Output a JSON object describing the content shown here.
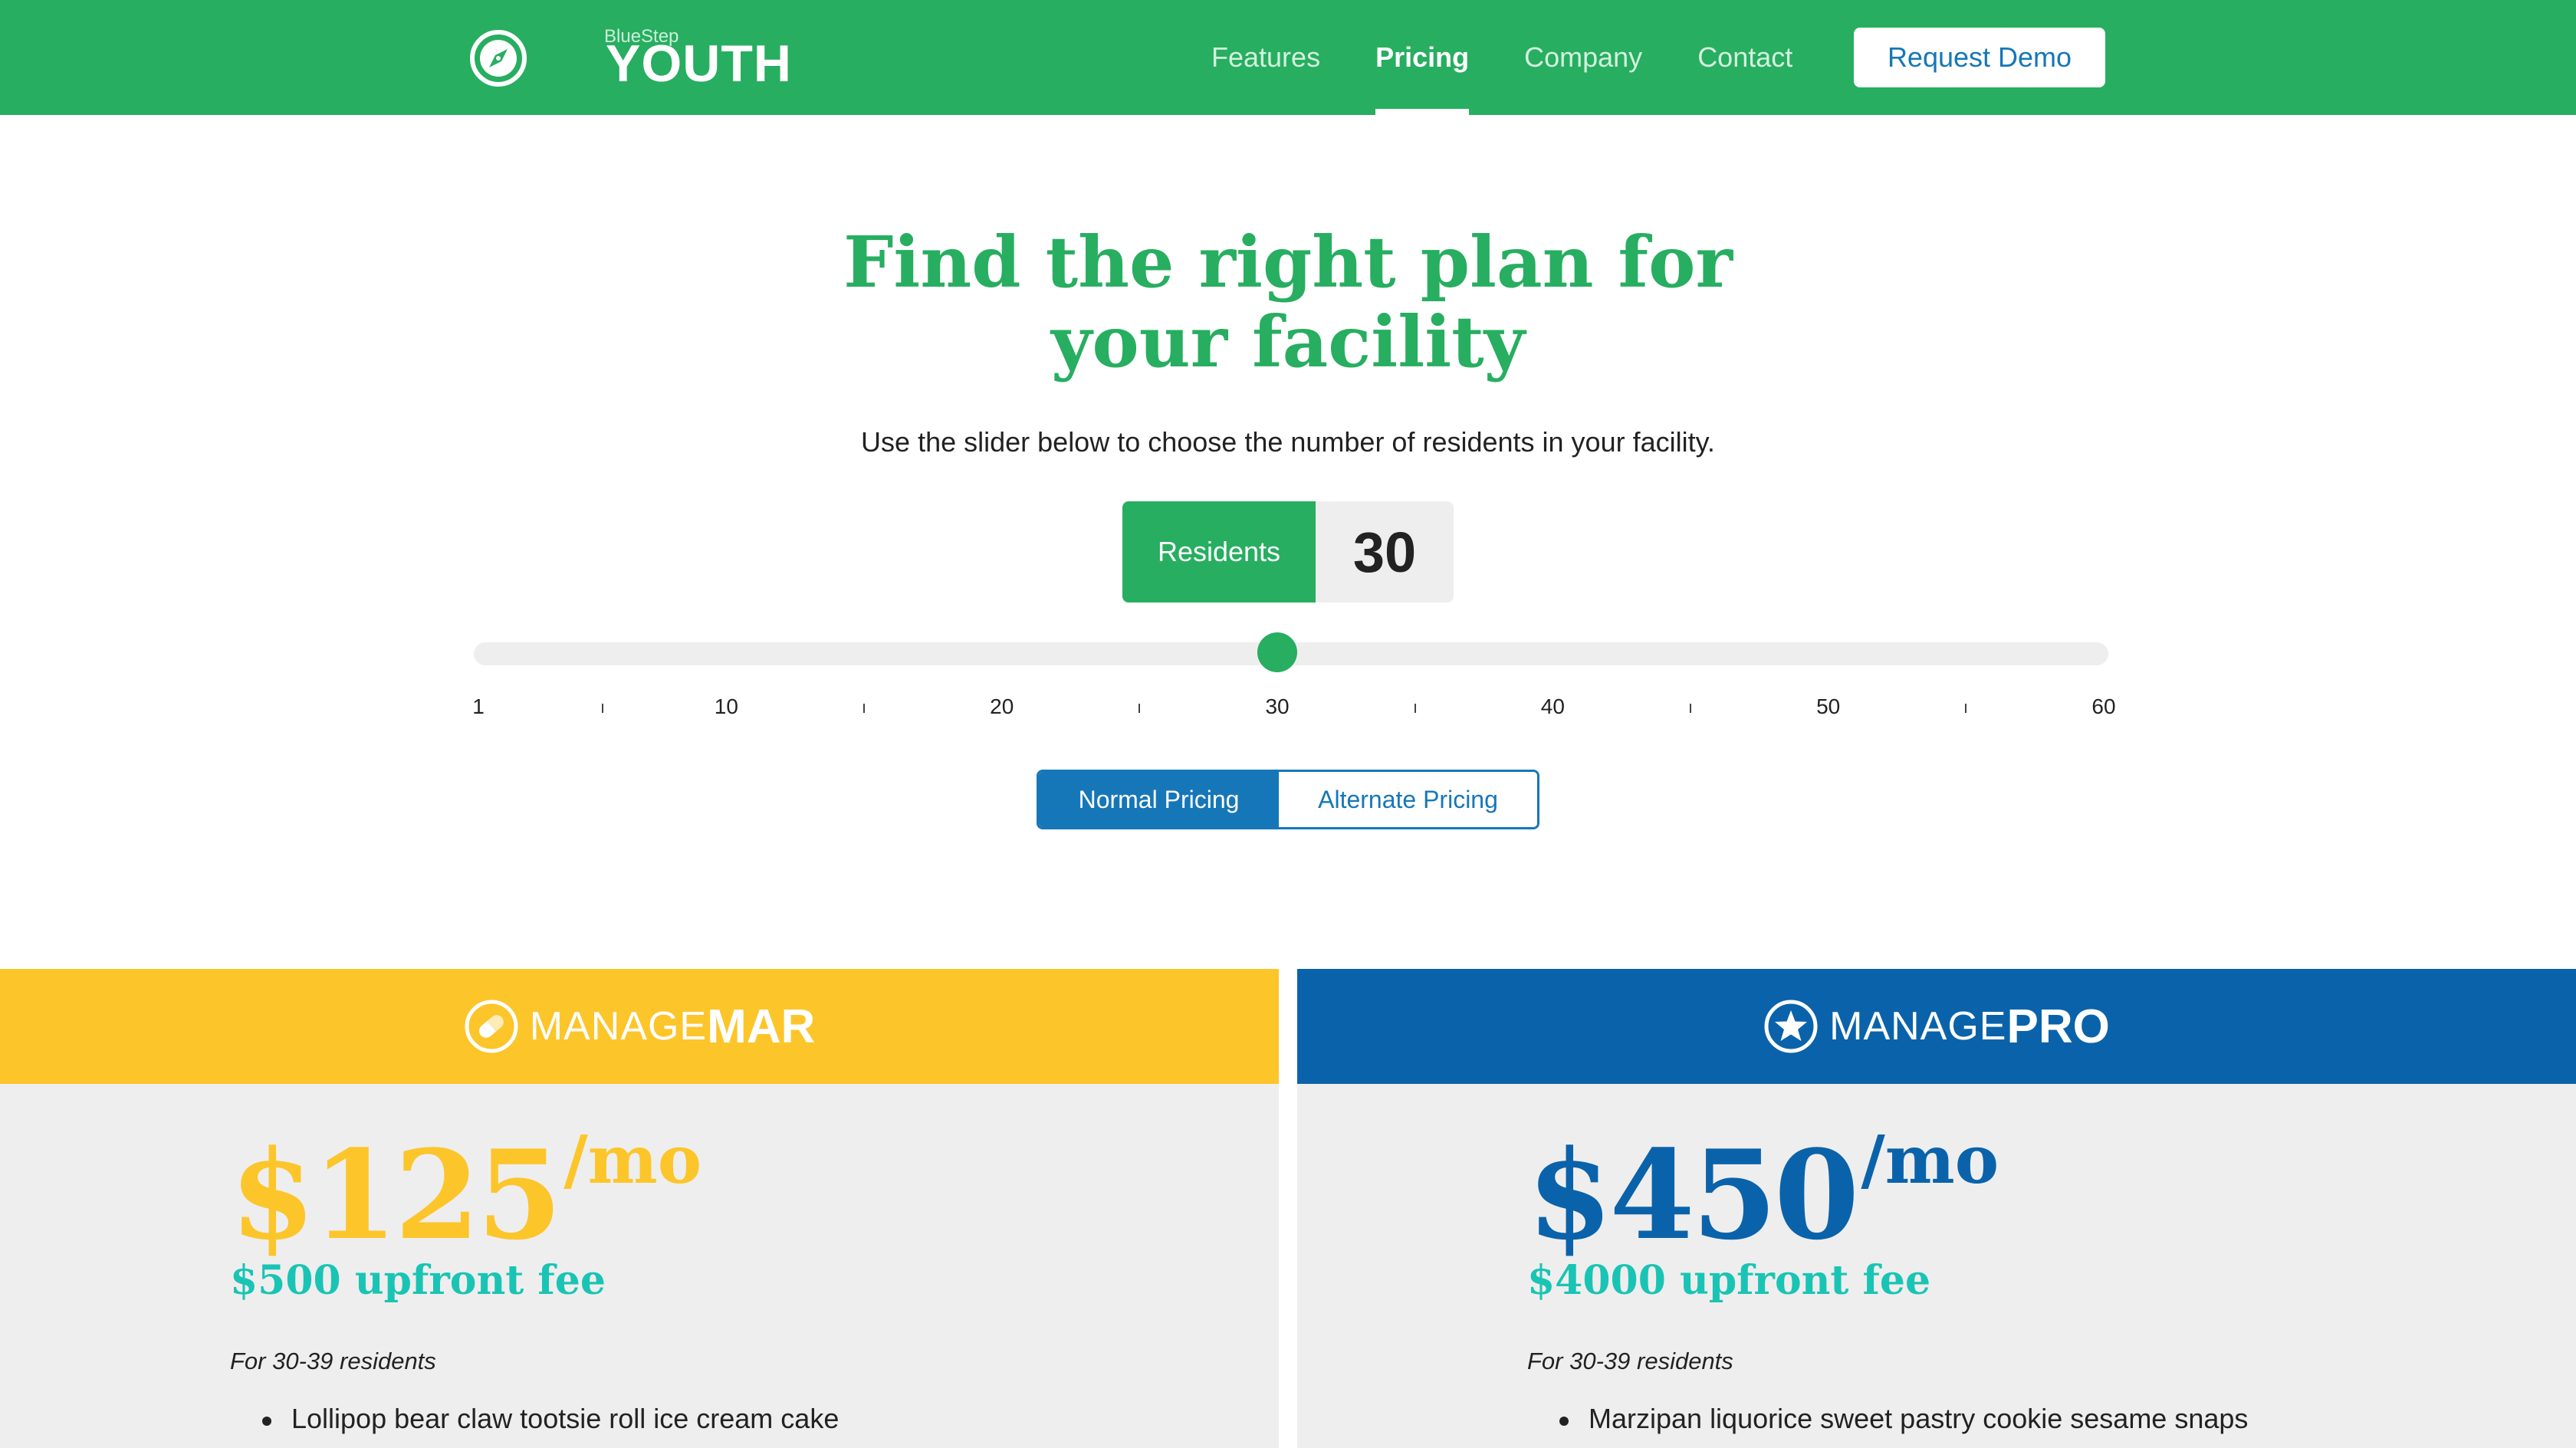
{
  "colors": {
    "brand_green": "#27ae60",
    "accent_blue": "#1677b8",
    "mar_yellow": "#fcc52a",
    "pro_blue": "#0a63aa",
    "fee_teal": "#1ac4b4"
  },
  "nav": {
    "logo_small": "BlueStep",
    "logo_big": "YOUTH",
    "logo_icon": "compass-icon",
    "links": [
      "Features",
      "Pricing",
      "Company",
      "Contact"
    ],
    "active_link": "Pricing",
    "demo_button": "Request Demo"
  },
  "hero": {
    "title_line1": "Find the right plan for",
    "title_line2": "your facility",
    "subtitle": "Use the slider below to choose the number of residents in your facility."
  },
  "residents": {
    "label": "Residents",
    "value": "30"
  },
  "slider": {
    "min": 1,
    "max": 60,
    "value": 30,
    "tick_labels": [
      "1",
      "10",
      "20",
      "30",
      "40",
      "50",
      "60"
    ]
  },
  "pricing_toggle": {
    "normal": "Normal Pricing",
    "alternate": "Alternate Pricing",
    "selected": "normal"
  },
  "plans": {
    "mar": {
      "icon": "pill-icon",
      "name_light": "MANAGE",
      "name_bold": "MAR",
      "price": "$125",
      "per": "/mo",
      "fee": "$500 upfront fee",
      "range": "For 30-39 residents",
      "features": [
        "Lollipop bear claw tootsie roll ice cream cake"
      ]
    },
    "pro": {
      "icon": "star-icon",
      "name_light": "MANAGE",
      "name_bold": "PRO",
      "price": "$450",
      "per": "/mo",
      "fee": "$4000 upfront fee",
      "range": "For 30-39 residents",
      "features": [
        "Marzipan liquorice sweet pastry cookie sesame snaps"
      ]
    }
  }
}
